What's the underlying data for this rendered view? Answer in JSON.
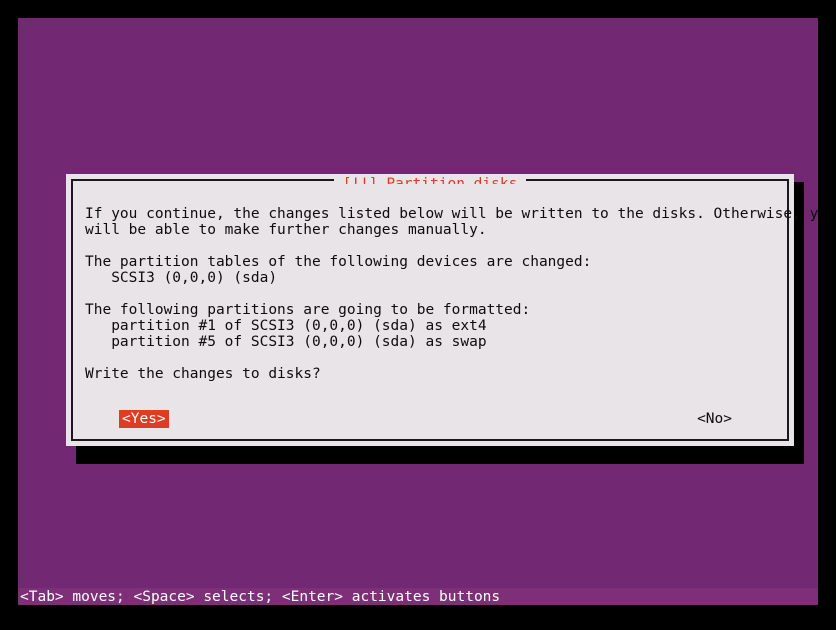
{
  "screen": {
    "background_color": "#000000",
    "canvas_color": "#722872"
  },
  "dialog": {
    "title": "[!!] Partition disks",
    "title_color": "#e03c24",
    "background_color": "#e8e4e8",
    "border_color": "#1a1a1a",
    "paragraphs": [
      "If you continue, the changes listed below will be written to the disks. Otherwise, you",
      "will be able to make further changes manually.",
      "",
      "The partition tables of the following devices are changed:",
      "   SCSI3 (0,0,0) (sda)",
      "",
      "The following partitions are going to be formatted:",
      "   partition #1 of SCSI3 (0,0,0) (sda) as ext4",
      "   partition #5 of SCSI3 (0,0,0) (sda) as swap",
      "",
      "Write the changes to disks?"
    ],
    "buttons": {
      "yes": {
        "label": "<Yes>",
        "selected": true,
        "selected_bg": "#e03c24",
        "selected_fg": "#ffffff"
      },
      "no": {
        "label": "<No>",
        "selected": false
      }
    }
  },
  "statusbar": {
    "text": "<Tab> moves; <Space> selects; <Enter> activates buttons",
    "background_color": "#7d2f78",
    "text_color": "#ffffff"
  }
}
